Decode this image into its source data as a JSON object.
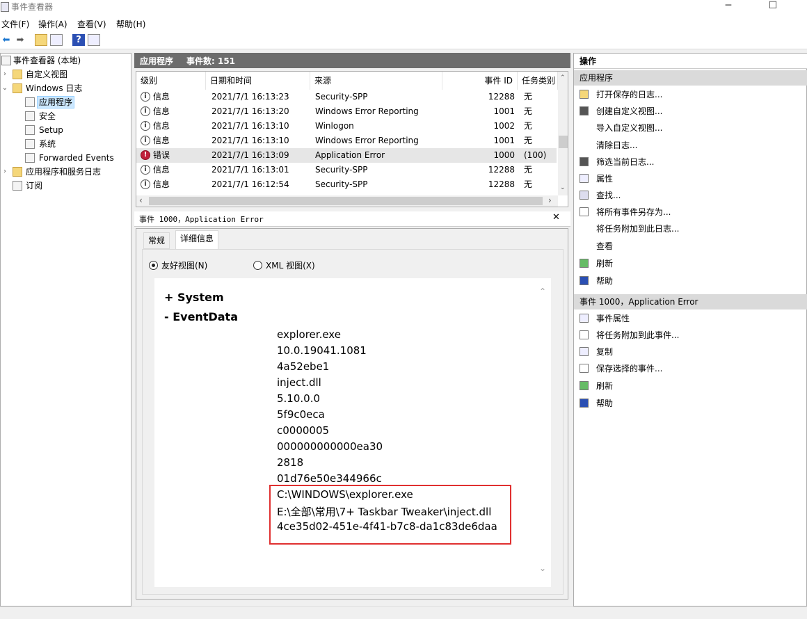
{
  "window": {
    "title": "事件查看器"
  },
  "menu": [
    "文件(F)",
    "操作(A)",
    "查看(V)",
    "帮助(H)"
  ],
  "tree": [
    {
      "label": "事件查看器 (本地)",
      "indent": 0,
      "chevron": ""
    },
    {
      "label": "自定义视图",
      "indent": 1,
      "chevron": "›"
    },
    {
      "label": "Windows 日志",
      "indent": 1,
      "chevron": "⌄"
    },
    {
      "label": "应用程序",
      "indent": 2,
      "chevron": "",
      "selected": true
    },
    {
      "label": "安全",
      "indent": 2,
      "chevron": ""
    },
    {
      "label": "Setup",
      "indent": 2,
      "chevron": ""
    },
    {
      "label": "系统",
      "indent": 2,
      "chevron": ""
    },
    {
      "label": "Forwarded Events",
      "indent": 2,
      "chevron": ""
    },
    {
      "label": "应用程序和服务日志",
      "indent": 1,
      "chevron": "›"
    },
    {
      "label": "订阅",
      "indent": 1,
      "chevron": ""
    }
  ],
  "list": {
    "title": "应用程序",
    "count": "事件数: 151",
    "columns": [
      "级别",
      "日期和时间",
      "来源",
      "事件 ID",
      "任务类别"
    ],
    "rows": [
      {
        "level": "信息",
        "datetime": "2021/7/1 16:13:23",
        "source": "Security-SPP",
        "id": "12288",
        "task": "无",
        "error": false
      },
      {
        "level": "信息",
        "datetime": "2021/7/1 16:13:20",
        "source": "Windows Error Reporting",
        "id": "1001",
        "task": "无",
        "error": false
      },
      {
        "level": "信息",
        "datetime": "2021/7/1 16:13:10",
        "source": "Winlogon",
        "id": "1002",
        "task": "无",
        "error": false
      },
      {
        "level": "信息",
        "datetime": "2021/7/1 16:13:10",
        "source": "Windows Error Reporting",
        "id": "1001",
        "task": "无",
        "error": false
      },
      {
        "level": "错误",
        "datetime": "2021/7/1 16:13:09",
        "source": "Application Error",
        "id": "1000",
        "task": "(100)",
        "error": true
      },
      {
        "level": "信息",
        "datetime": "2021/7/1 16:13:01",
        "source": "Security-SPP",
        "id": "12288",
        "task": "无",
        "error": false
      },
      {
        "level": "信息",
        "datetime": "2021/7/1 16:12:54",
        "source": "Security-SPP",
        "id": "12288",
        "task": "无",
        "error": false
      }
    ]
  },
  "detail": {
    "title": "事件 1000，Application Error",
    "tabs": [
      "常规",
      "详细信息"
    ],
    "radio_friendly": "友好视图(N)",
    "radio_xml": "XML 视图(X)",
    "system_label": "+  System",
    "eventdata_label": "-   EventData",
    "values": [
      "explorer.exe",
      "10.0.19041.1081",
      "4a52ebe1",
      "inject.dll",
      "5.10.0.0",
      "5f9c0eca",
      "c0000005",
      "000000000000ea30",
      "2818",
      "01d76e50e344966c",
      "C:\\WINDOWS\\explorer.exe",
      "E:\\全部\\常用\\7+ Taskbar Tweaker\\inject.dll",
      "4ce35d02-451e-4f41-b7c8-da1c83de6daa"
    ]
  },
  "actions": {
    "header": "操作",
    "section1": "应用程序",
    "items1": [
      "打开保存的日志...",
      "创建自定义视图...",
      "导入自定义视图...",
      "清除日志...",
      "筛选当前日志...",
      "属性",
      "查找...",
      "将所有事件另存为...",
      "将任务附加到此日志...",
      "查看",
      "刷新",
      "帮助"
    ],
    "section2": "事件 1000，Application Error",
    "items2": [
      "事件属性",
      "将任务附加到此事件...",
      "复制",
      "保存选择的事件...",
      "刷新",
      "帮助"
    ]
  }
}
